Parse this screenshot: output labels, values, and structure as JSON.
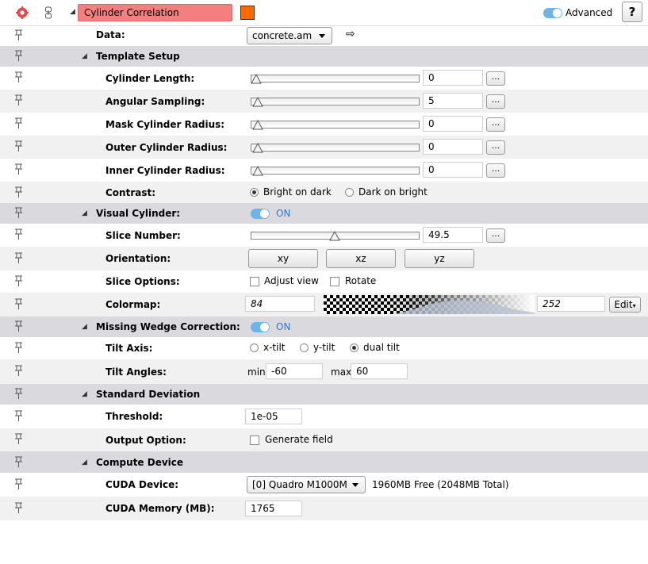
{
  "header": {
    "module_title": "Cylinder Correlation",
    "module_color": "#ff6a00",
    "advanced_label": "Advanced",
    "help_label": "?"
  },
  "data_row": {
    "label": "Data:",
    "value": "concrete.am"
  },
  "template_setup": {
    "title": "Template Setup",
    "sliders": [
      {
        "label": "Cylinder Length:",
        "value": "0",
        "fraction": 0
      },
      {
        "label": "Angular Sampling:",
        "value": "5",
        "fraction": 0
      },
      {
        "label": "Mask Cylinder Radius:",
        "value": "0",
        "fraction": 0
      },
      {
        "label": "Outer Cylinder Radius:",
        "value": "0",
        "fraction": 0
      },
      {
        "label": "Inner Cylinder Radius:",
        "value": "0",
        "fraction": 0
      }
    ],
    "dots_label": "...",
    "contrast": {
      "label": "Contrast:",
      "opt1": "Bright on dark",
      "opt2": "Dark on bright",
      "selected": "Bright on dark"
    }
  },
  "visual_cylinder": {
    "title": "Visual Cylinder:",
    "toggle_text": "ON",
    "slice_number": {
      "label": "Slice Number:",
      "value": "49.5",
      "fraction": 0.5
    },
    "orientation": {
      "label": "Orientation:",
      "b1": "xy",
      "b2": "xz",
      "b3": "yz"
    },
    "slice_options": {
      "label": "Slice Options:",
      "opt1": "Adjust view",
      "opt2": "Rotate"
    },
    "colormap": {
      "label": "Colormap:",
      "min": "84",
      "max": "252",
      "edit": "Edit"
    }
  },
  "missing_wedge": {
    "title": "Missing Wedge Correction:",
    "toggle_text": "ON",
    "tilt_axis": {
      "label": "Tilt Axis:",
      "opt1": "x-tilt",
      "opt2": "y-tilt",
      "opt3": "dual tilt",
      "selected": "dual tilt"
    },
    "tilt_angles": {
      "label": "Tilt Angles:",
      "min_label": "min",
      "min_value": "-60",
      "max_label": "max",
      "max_value": "60"
    }
  },
  "std_dev": {
    "title": "Standard Deviation",
    "threshold": {
      "label": "Threshold:",
      "value": "1e-05"
    },
    "output": {
      "label": "Output Option:",
      "opt1": "Generate field"
    }
  },
  "compute": {
    "title": "Compute Device",
    "cuda_device": {
      "label": "CUDA Device:",
      "value": "[0] Quadro M1000M",
      "info": "1960MB Free (2048MB Total)"
    },
    "cuda_memory": {
      "label": "CUDA Memory (MB):",
      "value": "1765"
    }
  }
}
